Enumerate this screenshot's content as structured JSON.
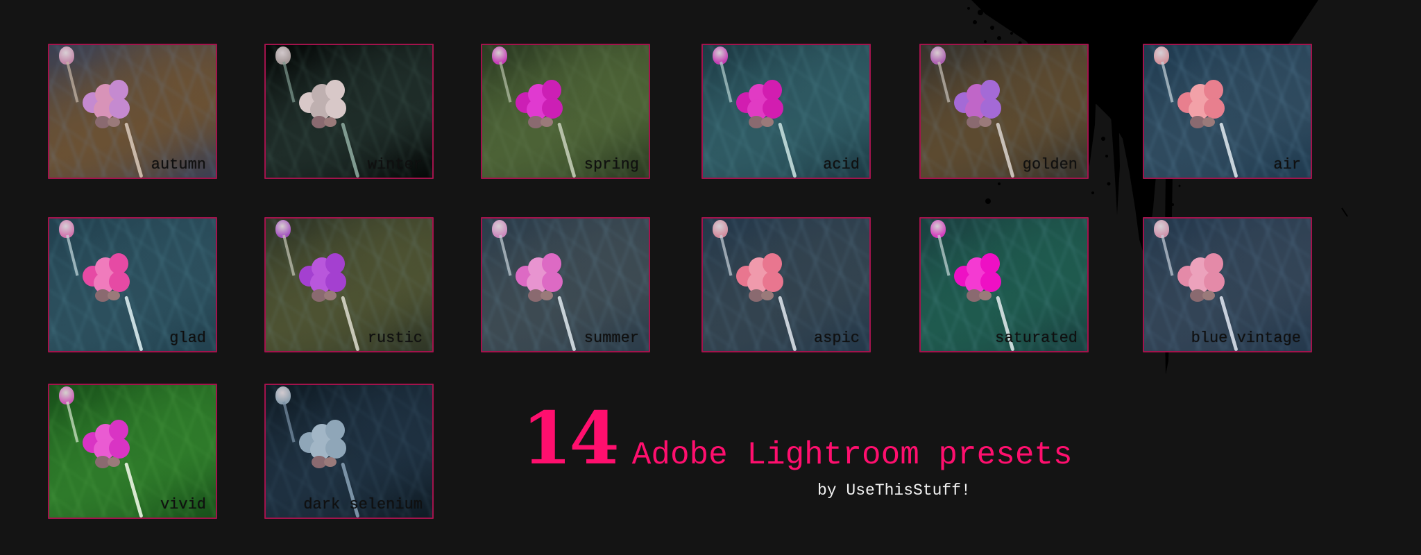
{
  "headline": {
    "count": "14",
    "text": "Adobe Lightroom presets",
    "byline": "by UseThisStuff!"
  },
  "colors": {
    "background": "#141414",
    "accent": "#ff0f6e",
    "tile_border": "#a3134c",
    "byline": "#f2f2f2",
    "label": "#101010"
  },
  "presets": [
    {
      "name": "autumn",
      "bg1": "#3a3f52",
      "bg2": "#6a5134",
      "grass": "#6b86a6",
      "flower": "#c58ad0",
      "flower2": "#d893b8",
      "stem": "#c9b8a8"
    },
    {
      "name": "winter",
      "bg1": "#050807",
      "bg2": "#1f2d29",
      "grass": "#4f6e66",
      "flower": "#d8c8c8",
      "flower2": "#bfb0b0",
      "stem": "#7f9a90"
    },
    {
      "name": "spring",
      "bg1": "#2b3a22",
      "bg2": "#4c6236",
      "grass": "#6f8a63",
      "flower": "#cc1fb5",
      "flower2": "#e03ad0",
      "stem": "#b6c0a8"
    },
    {
      "name": "acid",
      "bg1": "#1d3a44",
      "bg2": "#2f5a63",
      "grass": "#5d97a2",
      "flower": "#d21db0",
      "flower2": "#e13bc4",
      "stem": "#b5d0d0"
    },
    {
      "name": "golden",
      "bg1": "#36322c",
      "bg2": "#5c4a30",
      "grass": "#6f8798",
      "flower": "#a46ad6",
      "flower2": "#c066c8",
      "stem": "#c8c0b8"
    },
    {
      "name": "air",
      "bg1": "#1f3a4f",
      "bg2": "#2f4a5e",
      "grass": "#6d9cb8",
      "flower": "#e87f8e",
      "flower2": "#f2a1a8",
      "stem": "#c8d4dc"
    },
    {
      "name": "glad",
      "bg1": "#22414f",
      "bg2": "#2c4f5d",
      "grass": "#5e98a8",
      "flower": "#e64aa4",
      "flower2": "#f07bbc",
      "stem": "#c8dce0"
    },
    {
      "name": "rustic",
      "bg1": "#2e3526",
      "bg2": "#4d5232",
      "grass": "#6f8a8a",
      "flower": "#a440d0",
      "flower2": "#b957dc",
      "stem": "#c8c8b8"
    },
    {
      "name": "summer",
      "bg1": "#2b3c4a",
      "bg2": "#3d4a52",
      "grass": "#6a93a8",
      "flower": "#dd6ac4",
      "flower2": "#e894d0",
      "stem": "#c8d2d8"
    },
    {
      "name": "aspic",
      "bg1": "#24384a",
      "bg2": "#33434f",
      "grass": "#6488a0",
      "flower": "#e9768f",
      "flower2": "#f09aac",
      "stem": "#c8d0d8"
    },
    {
      "name": "saturated",
      "bg1": "#1a4040",
      "bg2": "#1f5a4e",
      "grass": "#5e9aa0",
      "flower": "#ee10c4",
      "flower2": "#f43ad2",
      "stem": "#c8d8d8"
    },
    {
      "name": "blue vintage",
      "bg1": "#24384c",
      "bg2": "#334456",
      "grass": "#6288a6",
      "flower": "#e48aa8",
      "flower2": "#eca2bc",
      "stem": "#c8d0dc"
    },
    {
      "name": "vivid",
      "bg1": "#18501a",
      "bg2": "#2e7a2a",
      "grass": "#5fb054",
      "flower": "#d934c4",
      "flower2": "#ea5bd2",
      "stem": "#d8e8d0"
    },
    {
      "name": "dark selenium",
      "bg1": "#0f1b24",
      "bg2": "#1e3040",
      "grass": "#4a6a80",
      "flower": "#8fa6b8",
      "flower2": "#a2b6c6",
      "stem": "#7a92a6"
    }
  ]
}
